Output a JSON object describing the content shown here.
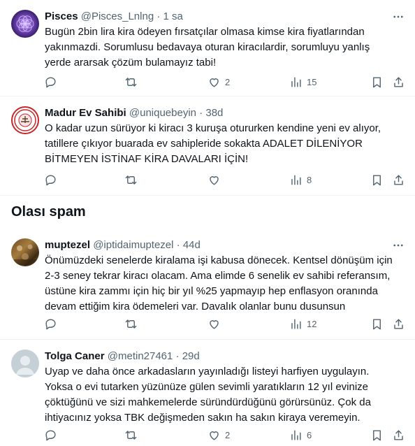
{
  "section_title": "Olası spam",
  "tweets": [
    {
      "name": "Pisces",
      "handle": "@Pisces_Lnlng",
      "sep": "·",
      "time": "1 sa",
      "text": "Bugün 2bin lira kira ödeyen fırsatçılar olmasa kimse kira fiyatlarından yakınmazdi. Sorumlusu bedavaya oturan kiracılardir, sorumluyu yanlış yerde ararsak çözüm bulamayız tabi!",
      "reply_count": "",
      "retweet_count": "",
      "like_count": "2",
      "view_count": "15"
    },
    {
      "name": "Madur Ev Sahibi",
      "handle": "@uniquebeyin",
      "sep": "·",
      "time": "38d",
      "text": "O kadar uzun sürüyor ki kiracı 3 kuruşa otururken kendine yeni ev alıyor, tatillere çıkıyor buarada ev sahipleride sokakta ADALET DİLENİYOR BİTMEYEN İSTİNAF KİRA DAVALARI İÇİN!",
      "reply_count": "",
      "retweet_count": "",
      "like_count": "",
      "view_count": "8"
    },
    {
      "name": "muptezel",
      "handle": "@iptidaimuptezel",
      "sep": "·",
      "time": "44d",
      "text": "Önümüzdeki senelerde kiralama işi kabusa dönecek. Kentsel dönüşüm için 2-3 seney tekrar kiracı olacam. Ama elimde 6 senelik ev sahibi referansım, üstüne kira zammı için hiç bir yıl %25 yapmayıp hep enflasyon oranında devam ettiğim kira ödemeleri var. Davalık olanlar bunu dusunsun",
      "reply_count": "",
      "retweet_count": "",
      "like_count": "",
      "view_count": "12"
    },
    {
      "name": "Tolga Caner",
      "handle": "@metin27461",
      "sep": "·",
      "time": "29d",
      "text": "Uyap ve daha önce arkadasların yayınladığı listeyi harfiyen uygulayın. Yoksa o evi tutarken yüzünüze gülen sevimli yaratıkların 12 yıl evinize çöktüğünü ve sizi mahkemelerde süründürdüğünü görürsünüz. Çok da ihtiyacınız yoksa TBK değişmeden sakın ha sakın kiraya veremeyin.",
      "reply_count": "",
      "retweet_count": "",
      "like_count": "2",
      "view_count": "6"
    }
  ],
  "colors": {
    "text": "#0f1419",
    "secondary": "#536471",
    "divider": "#eff3f4",
    "pisces_avatar": "#5b3a8c",
    "madur_avatar_border": "#c62828",
    "default_avatar": "#c4cfd6"
  },
  "icons": [
    "more-icon",
    "reply-icon",
    "retweet-icon",
    "like-icon",
    "views-icon",
    "bookmark-icon",
    "share-icon"
  ]
}
